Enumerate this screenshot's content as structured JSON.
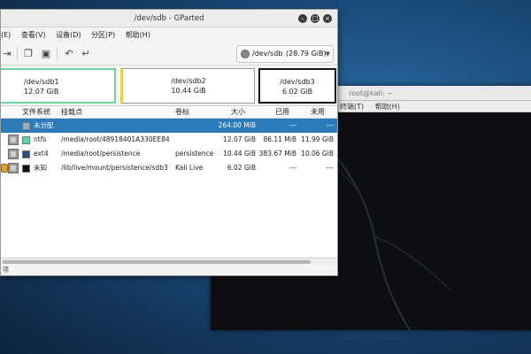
{
  "terminal": {
    "title": "root@kali: ~",
    "menu": [
      "终端(T)",
      "帮助(H)"
    ]
  },
  "gparted": {
    "title": "/dev/sdb - GParted",
    "menu": [
      "(E)",
      "查看(V)",
      "设备(D)",
      "分区(P)",
      "帮助(H)"
    ],
    "toolbar_icons": [
      "apply-icon",
      "copy-icon",
      "paste-icon",
      "undo-icon",
      "apply-all-icon"
    ],
    "device_selector": {
      "name": "/dev/sdb",
      "size": "(28.79 GiB)"
    },
    "partition_map": [
      {
        "name": "/dev/sdb1",
        "size": "12.07 GiB"
      },
      {
        "name": "/dev/sdb2",
        "size": "10.44 GiB"
      },
      {
        "name": "/dev/sdb3",
        "size": "6.02 GiB"
      }
    ],
    "columns": {
      "filesystem": "文件系统",
      "mountpoint": "挂载点",
      "label": "卷标",
      "size": "大小",
      "used": "已用",
      "unused": "未用"
    },
    "rows": [
      {
        "fs": "未分配",
        "mount": "",
        "label": "",
        "size": "264.00 MiB",
        "used": "---",
        "unused": "---",
        "swatch": "#a9a9a9"
      },
      {
        "fs": "ntfs",
        "mount": "/media/root/48918401A330EE84",
        "label": "",
        "size": "12.07 GiB",
        "used": "86.11 MiB",
        "unused": "11.99 GiB",
        "swatch": "#5fd3a0"
      },
      {
        "fs": "ext4",
        "mount": "/media/root/persistence",
        "label": "persistence",
        "size": "10.44 GiB",
        "used": "383.67 MiB",
        "unused": "10.06 GiB",
        "swatch": "#2e4d7a"
      },
      {
        "fs": "未知",
        "mount": "/lib/live/mount/persistence/sdb3",
        "label": "Kali Live",
        "size": "6.02 GiB",
        "used": "---",
        "unused": "---",
        "swatch": "#111111"
      }
    ],
    "status": "项"
  }
}
